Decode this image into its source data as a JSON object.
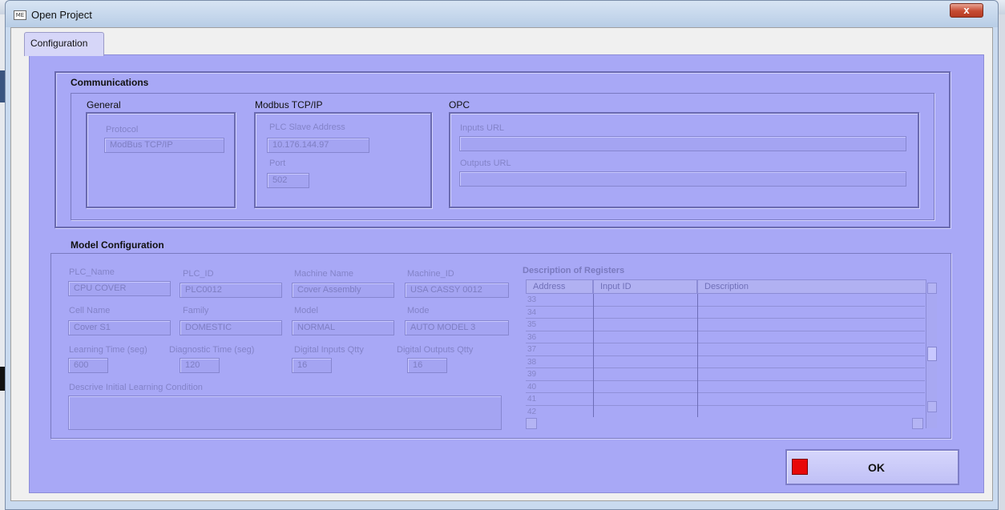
{
  "window": {
    "title": "Open Project",
    "icon_text": "ME",
    "close_glyph": "x"
  },
  "tab": {
    "label": "Configuration"
  },
  "communications": {
    "title": "Communications",
    "general": {
      "title": "General",
      "protocol_label": "Protocol",
      "protocol_value": "ModBus TCP/IP"
    },
    "modbus": {
      "title": "Modbus TCP/IP",
      "slave_label": "PLC Slave Address",
      "slave_value": "10.176.144.97",
      "port_label": "Port",
      "port_value": "502"
    },
    "opc": {
      "title": "OPC",
      "inputs_label": "Inputs URL",
      "inputs_value": "",
      "outputs_label": "Outputs URL",
      "outputs_value": ""
    }
  },
  "model": {
    "title": "Model Configuration",
    "plc_name_label": "PLC_Name",
    "plc_name_value": "CPU COVER",
    "plc_id_label": "PLC_ID",
    "plc_id_value": "PLC0012",
    "machine_name_label": "Machine Name",
    "machine_name_value": "Cover Assembly",
    "machine_id_label": "Machine_ID",
    "machine_id_value": "USA CASSY 0012",
    "cell_name_label": "Cell Name",
    "cell_name_value": "Cover S1",
    "family_label": "Family",
    "family_value": "DOMESTIC",
    "model_label": "Model",
    "model_value": "NORMAL",
    "mode_label": "Mode",
    "mode_value": "AUTO MODEL 3",
    "learning_label": "Learning Time (seg)",
    "learning_value": "600",
    "diagnostic_label": "Diagnostic Time (seg)",
    "diagnostic_value": "120",
    "din_label": "Digital Inputs Qtty",
    "din_value": "16",
    "dout_label": "Digital Outputs Qtty",
    "dout_value": "16",
    "condition_label": "Descrive Initial Learning Condition",
    "condition_value": ""
  },
  "registers": {
    "title": "Description of Registers",
    "columns": [
      "Address",
      "Input ID",
      "Description"
    ],
    "rows": [
      "33",
      "34",
      "35",
      "36",
      "37",
      "38",
      "39",
      "40",
      "41",
      "42"
    ]
  },
  "ok_button": {
    "label": "OK"
  },
  "colors": {
    "panel": "#a8a8f6",
    "led": "#e80808",
    "group_border": "#6a6ab0"
  }
}
